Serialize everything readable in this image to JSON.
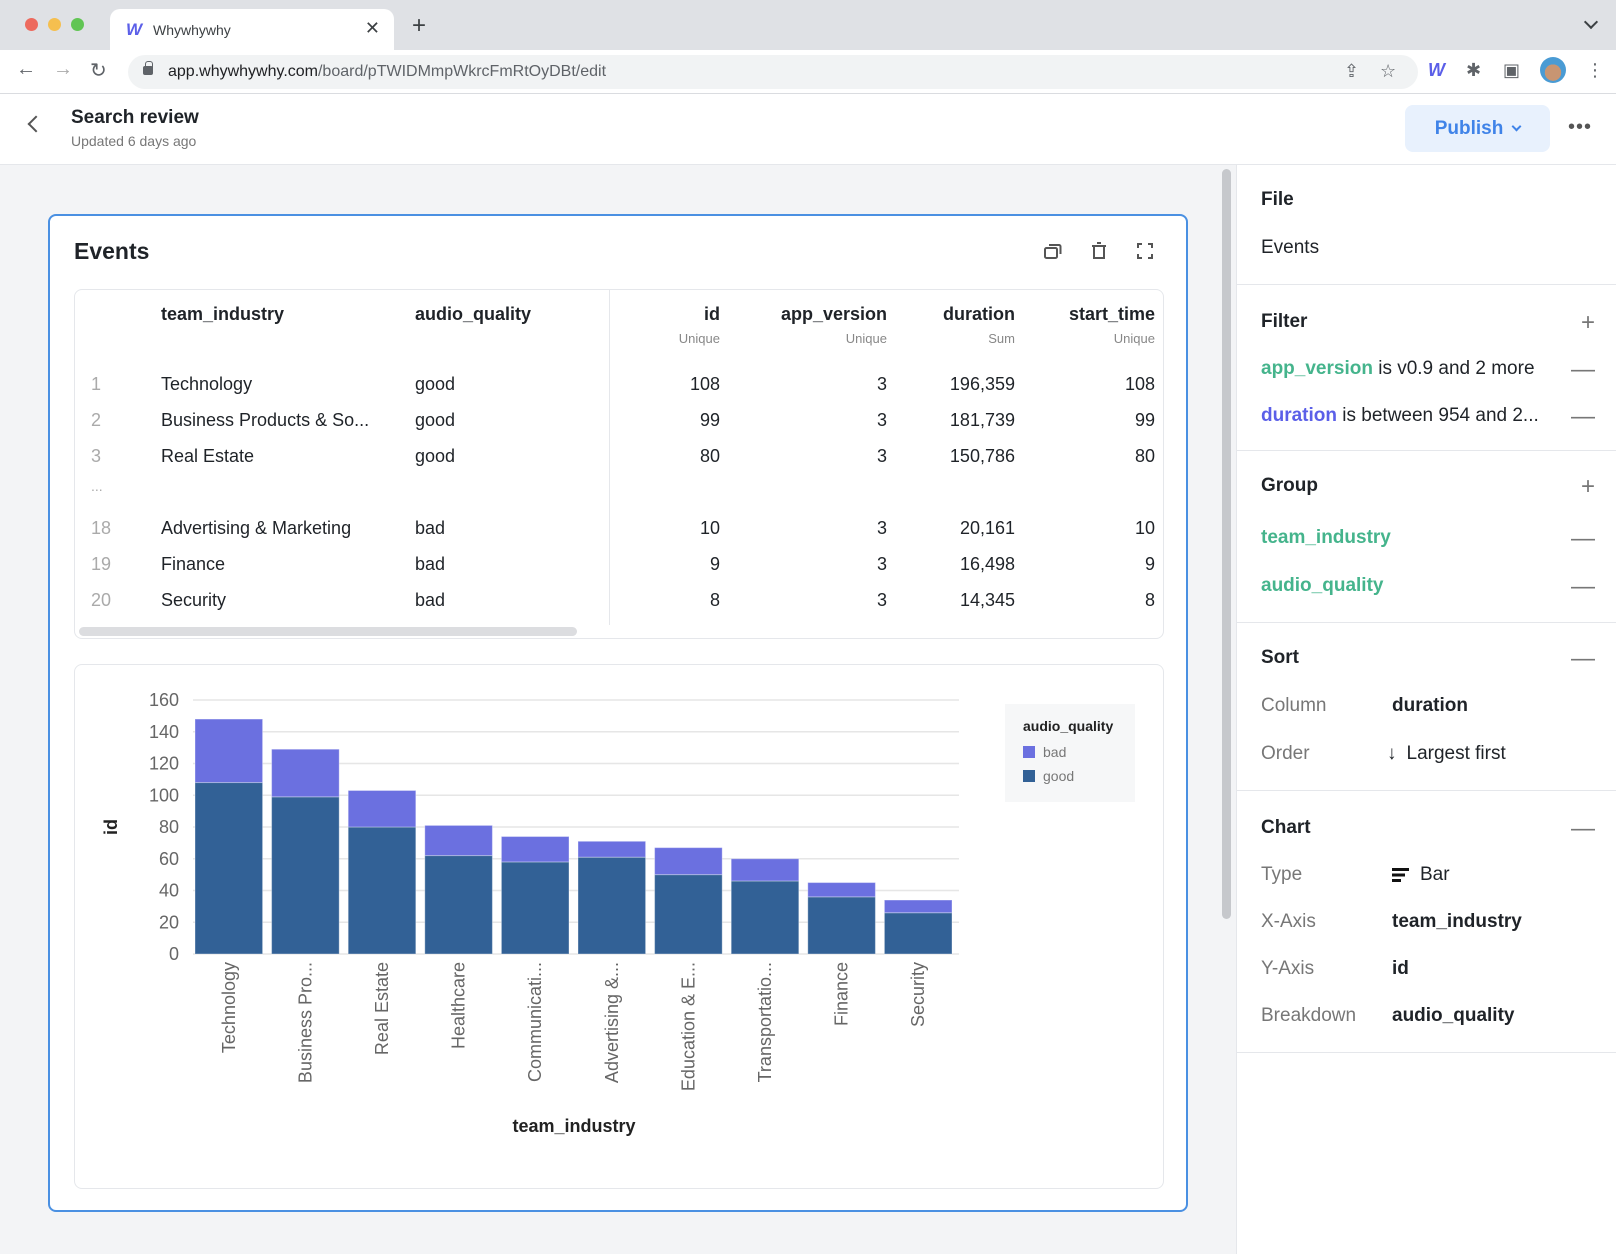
{
  "browser": {
    "tab_title": "Whywhywhy",
    "favicon": "W",
    "url_host": "app.whywhywhy.com",
    "url_path": "/board/pTWIDMmpWkrcFmRtOyDBt/edit"
  },
  "header": {
    "title": "Search review",
    "subtitle": "Updated 6 days ago",
    "publish_label": "Publish",
    "more_label": "•••"
  },
  "card": {
    "title": "Events",
    "table": {
      "columns": [
        {
          "name": "team_industry",
          "sub": ""
        },
        {
          "name": "audio_quality",
          "sub": ""
        },
        {
          "name": "id",
          "sub": "Unique"
        },
        {
          "name": "app_version",
          "sub": "Unique"
        },
        {
          "name": "duration",
          "sub": "Sum"
        },
        {
          "name": "start_time",
          "sub": "Unique"
        }
      ],
      "rows": [
        {
          "num": "1",
          "team_industry": "Technology",
          "audio_quality": "good",
          "id": "108",
          "app_version": "3",
          "duration": "196,359",
          "start_time": "108"
        },
        {
          "num": "2",
          "team_industry": "Business Products & So...",
          "audio_quality": "good",
          "id": "99",
          "app_version": "3",
          "duration": "181,739",
          "start_time": "99"
        },
        {
          "num": "3",
          "team_industry": "Real Estate",
          "audio_quality": "good",
          "id": "80",
          "app_version": "3",
          "duration": "150,786",
          "start_time": "80"
        },
        {
          "num": "...",
          "team_industry": "",
          "audio_quality": "",
          "id": "",
          "app_version": "",
          "duration": "",
          "start_time": ""
        },
        {
          "num": "18",
          "team_industry": "Advertising & Marketing",
          "audio_quality": "bad",
          "id": "10",
          "app_version": "3",
          "duration": "20,161",
          "start_time": "10"
        },
        {
          "num": "19",
          "team_industry": "Finance",
          "audio_quality": "bad",
          "id": "9",
          "app_version": "3",
          "duration": "16,498",
          "start_time": "9"
        },
        {
          "num": "20",
          "team_industry": "Security",
          "audio_quality": "bad",
          "id": "8",
          "app_version": "3",
          "duration": "14,345",
          "start_time": "8"
        }
      ]
    }
  },
  "chart_data": {
    "type": "bar",
    "stacked": true,
    "title": "",
    "xlabel": "team_industry",
    "ylabel": "id",
    "ylim": [
      0,
      160
    ],
    "yticks": [
      0,
      20,
      40,
      60,
      80,
      100,
      120,
      140,
      160
    ],
    "grid": true,
    "legend_title": "audio_quality",
    "legend_position": "top-right",
    "categories": [
      "Technology",
      "Business Pro...",
      "Real Estate",
      "Healthcare",
      "Communicati...",
      "Advertising &...",
      "Education & E...",
      "Transportatio...",
      "Finance",
      "Security"
    ],
    "series": [
      {
        "name": "good",
        "color": "#326196",
        "values": [
          108,
          99,
          80,
          62,
          58,
          61,
          50,
          46,
          36,
          26
        ]
      },
      {
        "name": "bad",
        "color": "#6b70e0",
        "values": [
          40,
          30,
          23,
          19,
          16,
          10,
          17,
          14,
          9,
          8
        ]
      }
    ],
    "legend_order": [
      "bad",
      "good"
    ]
  },
  "panel": {
    "file": {
      "title": "File",
      "value": "Events"
    },
    "filter": {
      "title": "Filter",
      "add": "+",
      "items": [
        {
          "field": "app_version",
          "text": " is v0.9 and 2 more",
          "color": "green"
        },
        {
          "field": "duration",
          "text": " is between 954 and 2...",
          "color": "blue"
        }
      ]
    },
    "group": {
      "title": "Group",
      "add": "+",
      "items": [
        "team_industry",
        "audio_quality"
      ]
    },
    "sort": {
      "title": "Sort",
      "column_label": "Column",
      "column_value": "duration",
      "order_label": "Order",
      "order_value": "Largest first",
      "order_arrow": "↓"
    },
    "chart": {
      "title": "Chart",
      "type_label": "Type",
      "type_value": "Bar",
      "x_label": "X-Axis",
      "x_value": "team_industry",
      "y_label": "Y-Axis",
      "y_value": "id",
      "breakdown_label": "Breakdown",
      "breakdown_value": "audio_quality"
    },
    "remove": "—"
  }
}
